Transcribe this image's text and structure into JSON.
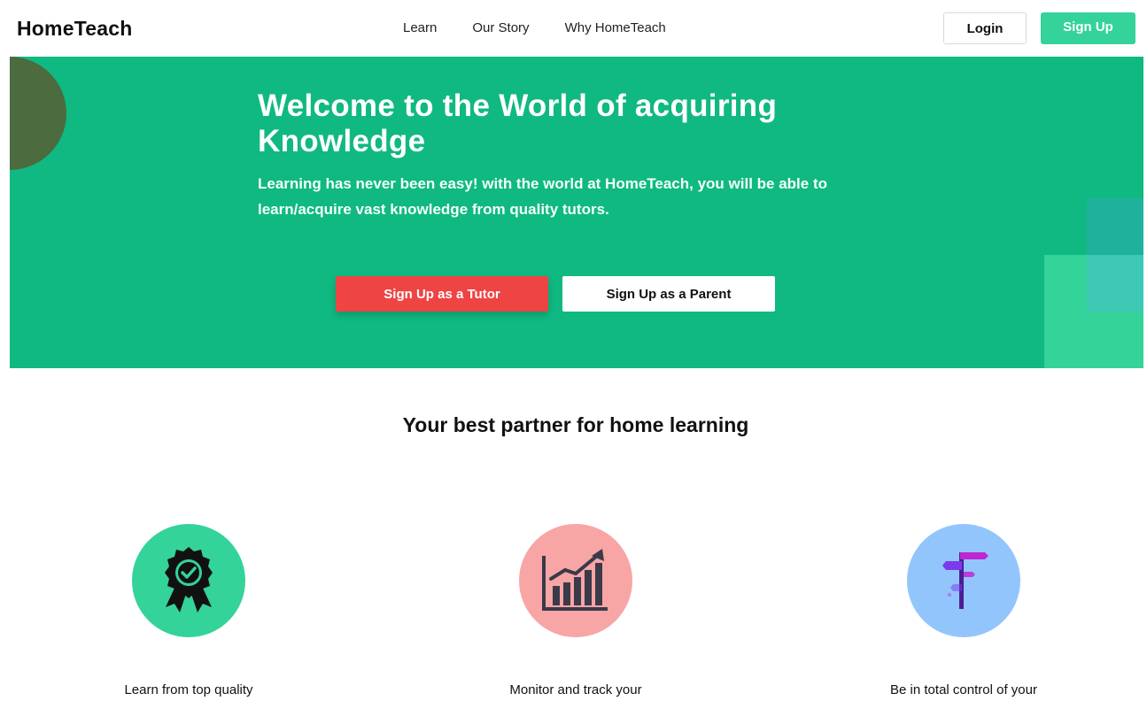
{
  "header": {
    "logo": "HomeTeach",
    "nav": [
      "Learn",
      "Our Story",
      "Why HomeTeach"
    ],
    "login_label": "Login",
    "signup_label": "Sign Up"
  },
  "hero": {
    "title": "Welcome to the World of acquiring Knowledge",
    "subtitle": "Learning has never been easy! with the world at HomeTeach, you will be able to learn/acquire vast knowledge from quality tutors.",
    "tutor_button": "Sign Up as a Tutor",
    "parent_button": "Sign Up as a Parent",
    "bg_color": "#10b981"
  },
  "section": {
    "title": "Your best partner for home learning",
    "features": [
      {
        "icon": "award-badge-icon",
        "color": "#34d399",
        "text": "Learn from top quality"
      },
      {
        "icon": "growth-chart-icon",
        "color": "#f8a5a5",
        "text": "Monitor and track your"
      },
      {
        "icon": "signpost-icon",
        "color": "#93c5fd",
        "text": "Be in total control of your"
      }
    ]
  },
  "colors": {
    "accent": "#34d399",
    "danger": "#ef4444"
  }
}
